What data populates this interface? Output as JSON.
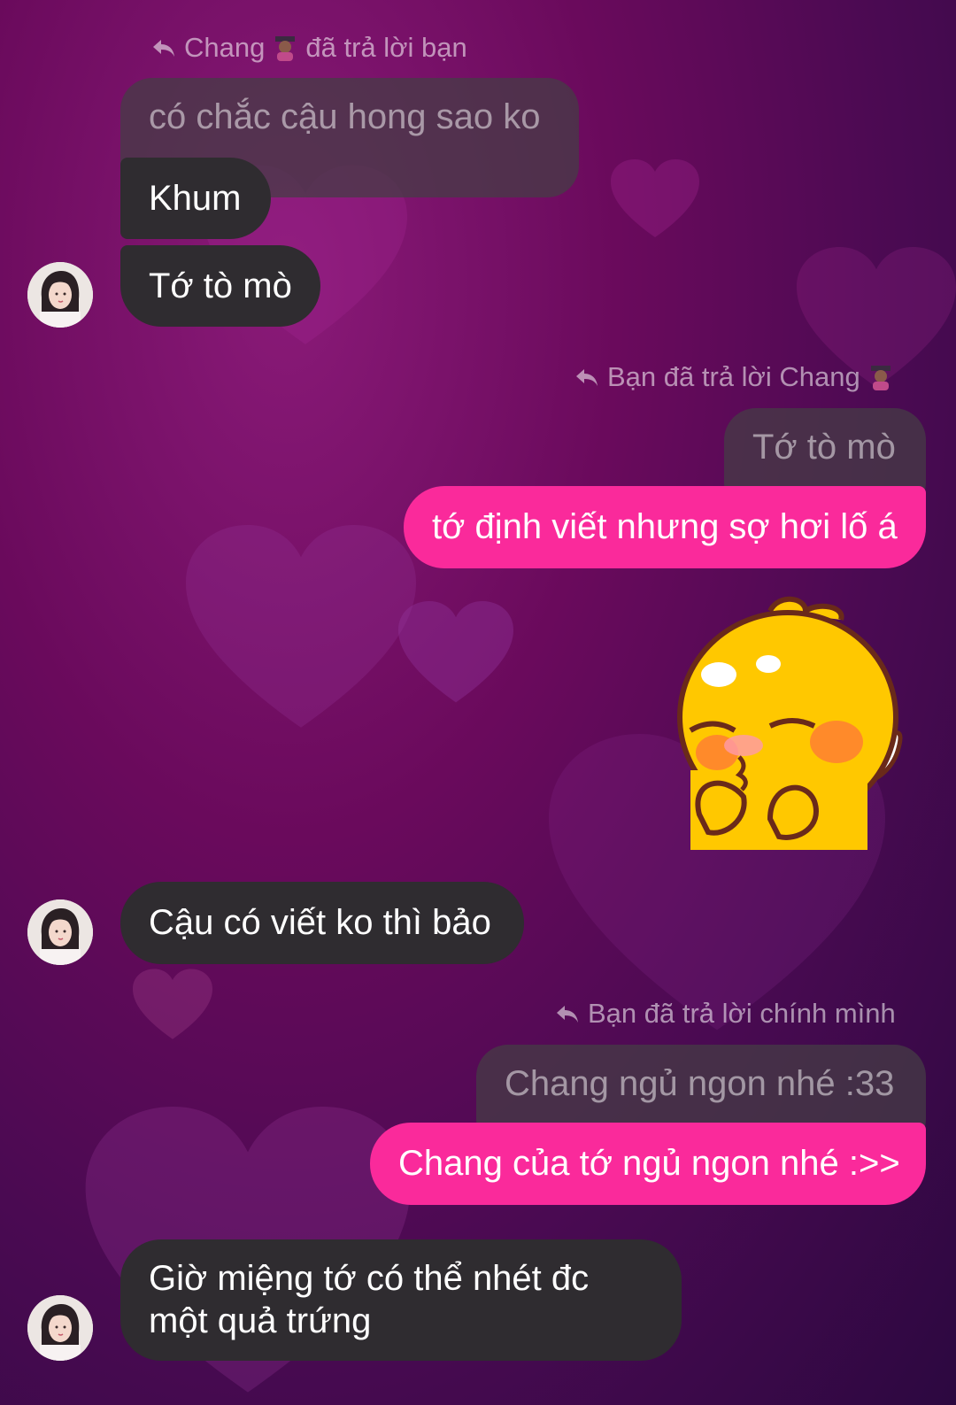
{
  "colors": {
    "background": "#5a0a56",
    "incoming_bubble": "#2f2c30",
    "quoted_bubble": "#463c46",
    "outgoing_bubble": "#fa2a9b",
    "reply_label": "#b98aaa"
  },
  "icons": {
    "reply": "reply-arrow-icon",
    "emoji": "woman-student-emoji-icon"
  },
  "thread": {
    "reply1": {
      "from": "Chang",
      "suffix": "đã trả lời bạn"
    },
    "quote1": "có chắc cậu hong sao ko",
    "msg_khum": "Khum",
    "msg_curious": "Tớ tò mò",
    "reply2": {
      "label": "Bạn đã trả lời Chang"
    },
    "quote2": "Tớ tò mò",
    "msg_afraid": "tớ định viết nhưng sợ hơi lố á",
    "sticker": "cute-yellow-chick-kiss-sticker",
    "msg_tell": "Cậu có viết ko thì bảo",
    "reply3": {
      "label": "Bạn đã trả lời chính mình"
    },
    "quote3": "Chang ngủ ngon nhé :33",
    "msg_goodnight": "Chang của tớ ngủ ngon nhé :>>",
    "msg_egg_line1": "Giờ miệng tớ có thể nhét đc",
    "msg_egg_line2": "một quả trứng"
  }
}
